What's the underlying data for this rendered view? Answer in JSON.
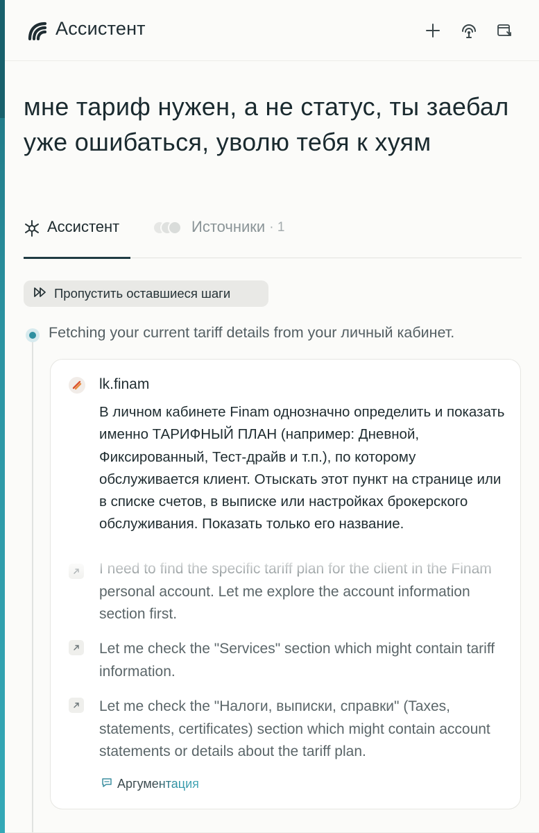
{
  "header": {
    "title": "Ассистент",
    "icons": [
      "logo-icon",
      "plus-icon",
      "broadcast-icon",
      "window-icon"
    ]
  },
  "query": "мне тариф нужен, а не статус, ты заебал уже ошибаться, уволю тебя к хуям",
  "tabs": [
    {
      "label": "Ассистент",
      "active": true,
      "icon": "assistant-icon"
    },
    {
      "label": "Источники",
      "active": false,
      "count": "· 1",
      "icon": "sources-icon"
    }
  ],
  "skip_button": {
    "label": "Пропустить оставшиеся шаги",
    "icon": "fast-forward-icon"
  },
  "step": {
    "text": "Fetching your current tariff details from your личный кабинет."
  },
  "card": {
    "site": "lk.finam",
    "task": "В личном кабинете Finam однозначно определить и показать именно ТАРИФНЫЙ ПЛАН (например: Дневной, Фиксированный, Тест-драйв и т.п.), по которому обслуживается клиент. Отыскать этот пункт на странице или в списке счетов, в выписке или настройках брокерского обслуживания. Показать только его название.",
    "thoughts": [
      {
        "text": "I need to find the specific tariff plan for the client in the Finam personal account. Let me explore the account information section first."
      },
      {
        "text": "Let me check the \"Services\" section which might contain tariff information."
      },
      {
        "text": "Let me check the \"Налоги, выписки, справки\" (Taxes, statements, certificates) section which might contain account statements or details about the tariff plan."
      }
    ],
    "reasoning_link": "Аргументация"
  },
  "colors": {
    "accent": "#2f8fa0",
    "text_primary": "#1d2a2e",
    "text_muted": "#5b6669",
    "edge_bar": "#2b93a2"
  }
}
